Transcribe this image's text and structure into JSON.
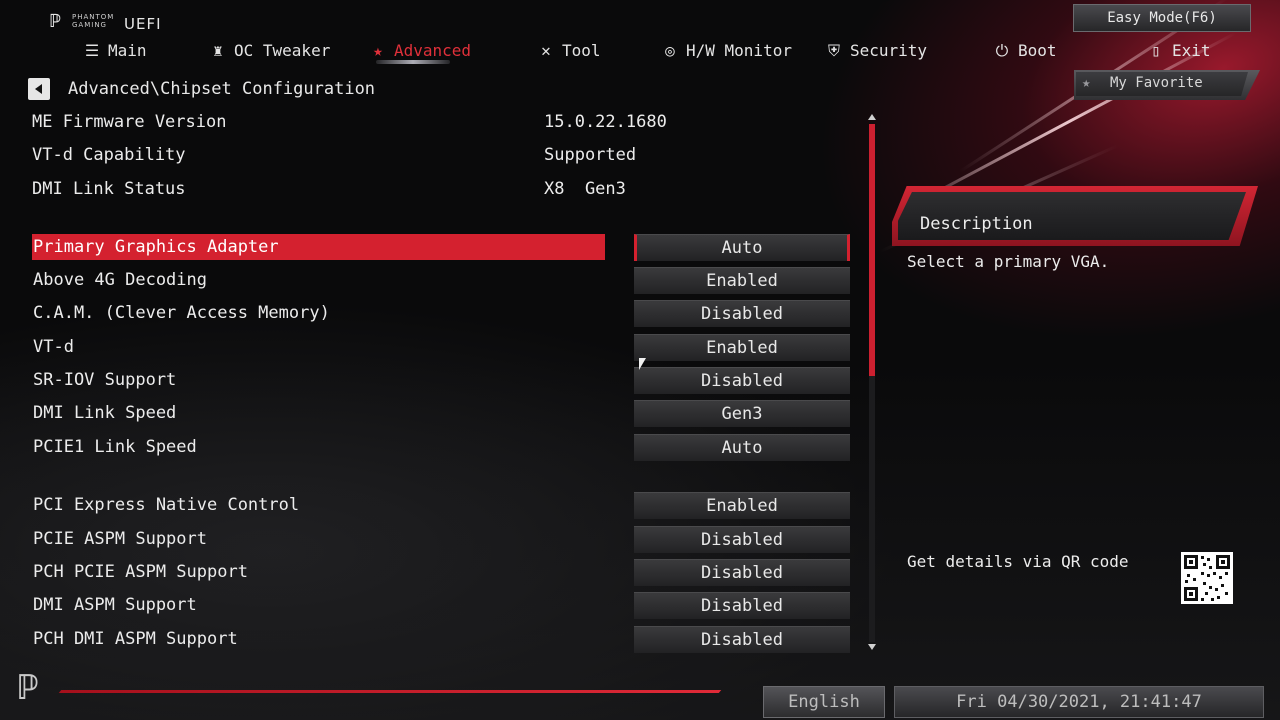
{
  "header": {
    "logo_small_line1": "PHANTOM",
    "logo_small_line2": "GAMING",
    "logo_uefi": "UEFI",
    "easy_mode": "Easy Mode(F6)"
  },
  "nav": {
    "items": [
      {
        "label": "Main",
        "icon": "list-icon"
      },
      {
        "label": "OC Tweaker",
        "icon": "rocket-icon"
      },
      {
        "label": "Advanced",
        "icon": "star-icon",
        "active": true
      },
      {
        "label": "Tool",
        "icon": "tool-icon"
      },
      {
        "label": "H/W Monitor",
        "icon": "monitor-icon"
      },
      {
        "label": "Security",
        "icon": "shield-icon"
      },
      {
        "label": "Boot",
        "icon": "power-icon"
      },
      {
        "label": "Exit",
        "icon": "exit-icon"
      }
    ]
  },
  "breadcrumb": "Advanced\\Chipset Configuration",
  "my_favorite": "My Favorite",
  "info": [
    {
      "label": "ME Firmware Version",
      "value": "15.0.22.1680"
    },
    {
      "label": "VT-d Capability",
      "value": "Supported"
    },
    {
      "label": "DMI Link Status",
      "value": "X8  Gen3"
    }
  ],
  "settings": [
    {
      "label": "Primary Graphics Adapter",
      "value": "Auto",
      "selected": true
    },
    {
      "label": "Above 4G Decoding",
      "value": "Enabled"
    },
    {
      "label": "C.A.M. (Clever Access Memory)",
      "value": "Disabled"
    },
    {
      "label": "VT-d",
      "value": "Enabled"
    },
    {
      "label": "SR-IOV Support",
      "value": "Disabled"
    },
    {
      "label": "DMI Link Speed",
      "value": "Gen3"
    },
    {
      "label": "PCIE1 Link Speed",
      "value": "Auto"
    },
    {
      "label": "PCI Express Native Control",
      "value": "Enabled"
    },
    {
      "label": "PCIE ASPM Support",
      "value": "Disabled"
    },
    {
      "label": "PCH PCIE ASPM Support",
      "value": "Disabled"
    },
    {
      "label": "DMI ASPM Support",
      "value": "Disabled"
    },
    {
      "label": "PCH DMI ASPM Support",
      "value": "Disabled"
    }
  ],
  "description": {
    "title": "Description",
    "text": "Select a primary VGA."
  },
  "qr": {
    "text": "Get details via QR code"
  },
  "footer": {
    "language": "English",
    "datetime": "Fri 04/30/2021, 21:41:47"
  },
  "colors": {
    "accent": "#d4212f",
    "background": "#0a0a0b"
  }
}
